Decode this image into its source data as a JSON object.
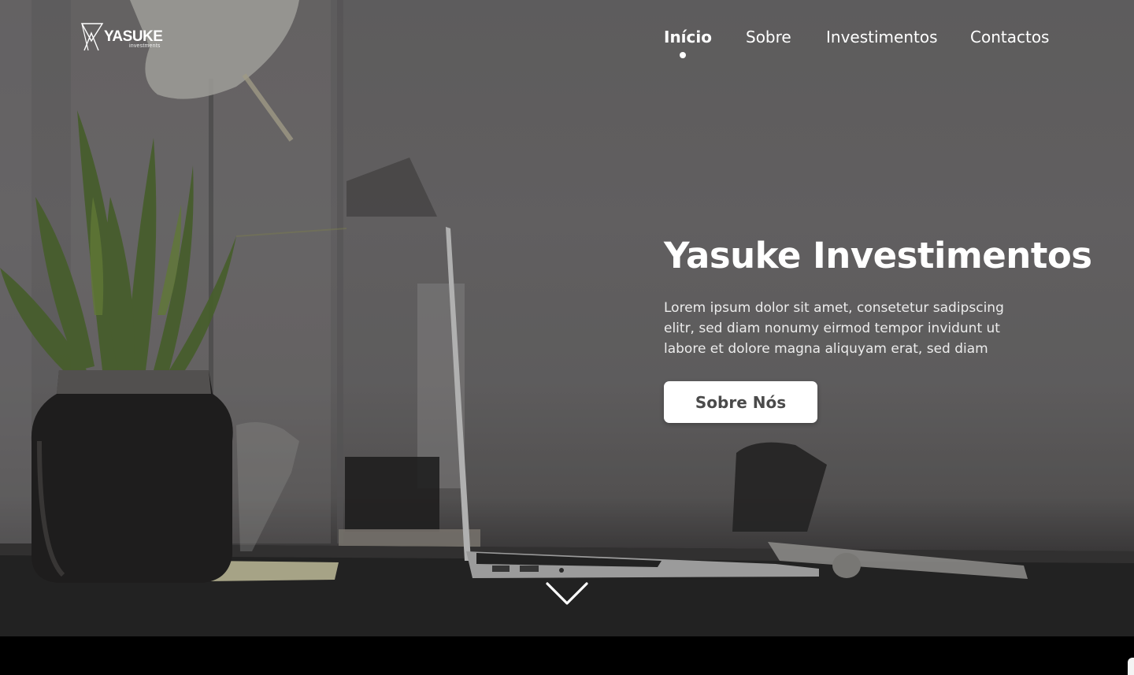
{
  "brand": {
    "name": "YASUKE",
    "subtitle": "investments",
    "logo_icon": "yasuke-logo-icon"
  },
  "nav": {
    "items": [
      {
        "label": "Início",
        "active": true
      },
      {
        "label": "Sobre",
        "active": false
      },
      {
        "label": "Investimentos",
        "active": false
      },
      {
        "label": "Contactos",
        "active": false
      }
    ]
  },
  "hero": {
    "title": "Yasuke Investimentos",
    "text": "Lorem ipsum dolor sit amet, consetetur sadipscing\nelitr, sed diam  nonumy eirmod tempor invidunt ut\nlabore et dolore magna  aliquyam erat, sed diam",
    "cta_label": "Sobre Nós",
    "scroll_icon": "chevron-down-icon",
    "background_image": "office desk with potted plant in glass jar, laptop and keyboard"
  },
  "colors": {
    "text": "#ffffff",
    "button_bg": "#ffffff",
    "button_text": "#4a4a4a",
    "footer_bar": "#000000"
  }
}
